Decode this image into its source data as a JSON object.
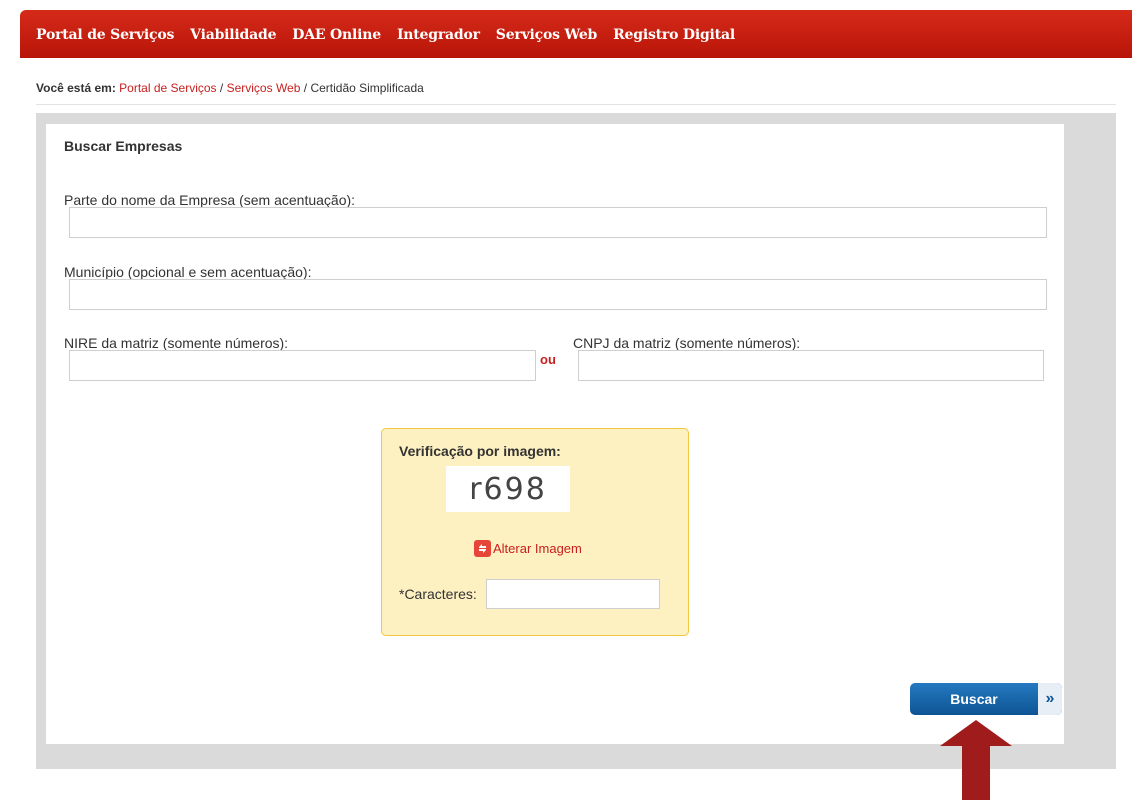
{
  "nav": {
    "items": [
      "Portal de Serviços",
      "Viabilidade",
      "DAE Online",
      "Integrador",
      "Serviços Web",
      "Registro Digital"
    ]
  },
  "breadcrumb": {
    "lead": "Você está em:",
    "links": [
      "Portal de Serviços",
      "Serviços Web"
    ],
    "separator": "/",
    "current": "Certidão Simplificada"
  },
  "form": {
    "title": "Buscar Empresas",
    "name_label": "Parte do nome da Empresa (sem acentuação):",
    "name_value": "",
    "municipio_label": "Município (opcional e sem acentuação):",
    "municipio_value": "",
    "nire_label": "NIRE da matriz (somente números):",
    "nire_value": "",
    "or_label": "ou",
    "cnpj_label": "CNPJ da matriz (somente números):",
    "cnpj_value": ""
  },
  "captcha": {
    "title": "Verificação por imagem:",
    "image_text": "r698",
    "refresh_icon": "refresh-icon",
    "refresh_label": "Alterar Imagem",
    "chars_label": "*Caracteres:",
    "chars_value": ""
  },
  "search_button": {
    "label": "Buscar",
    "arrow_icon": "double-chevron-right-icon",
    "arrow_glyph": "»"
  },
  "colors": {
    "nav_red": "#c8201e",
    "link_red": "#c8201e",
    "captcha_bg": "#fdf0c1",
    "captcha_border": "#f1c842",
    "button_blue": "#0e5494",
    "annotation_arrow": "#a01c1c"
  }
}
